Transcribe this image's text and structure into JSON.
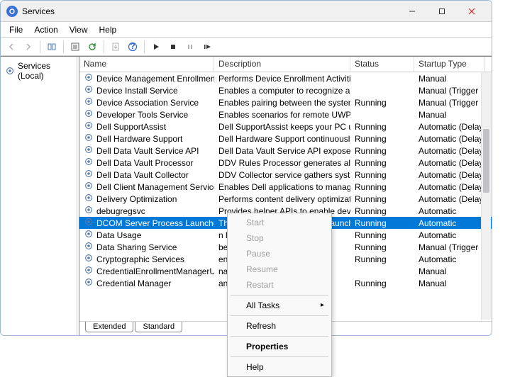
{
  "window": {
    "title": "Services"
  },
  "menu": {
    "file": "File",
    "action": "Action",
    "view": "View",
    "help": "Help"
  },
  "tree": {
    "root": "Services (Local)"
  },
  "columns": {
    "name": "Name",
    "desc": "Description",
    "status": "Status",
    "startup": "Startup Type"
  },
  "services": [
    {
      "name": "Device Management Enrollment Service",
      "desc": "Performs Device Enrollment Activities f...",
      "status": "",
      "startup": "Manual"
    },
    {
      "name": "Device Install Service",
      "desc": "Enables a computer to recognize and a...",
      "status": "",
      "startup": "Manual (Trigger St..."
    },
    {
      "name": "Device Association Service",
      "desc": "Enables pairing between the system an...",
      "status": "Running",
      "startup": "Manual (Trigger St..."
    },
    {
      "name": "Developer Tools Service",
      "desc": "Enables scenarios for remote UWP appli...",
      "status": "",
      "startup": "Manual"
    },
    {
      "name": "Dell SupportAssist",
      "desc": "Dell SupportAssist keeps your PC up to ...",
      "status": "Running",
      "startup": "Automatic (Delaye..."
    },
    {
      "name": "Dell Hardware Support",
      "desc": "Dell Hardware Support continuously m...",
      "status": "Running",
      "startup": "Automatic (Delaye..."
    },
    {
      "name": "Dell Data Vault Service API",
      "desc": "Dell Data Vault Service API exposes a C...",
      "status": "Running",
      "startup": "Automatic (Delaye..."
    },
    {
      "name": "Dell Data Vault Processor",
      "desc": "DDV Rules Processor generates alerts ba...",
      "status": "Running",
      "startup": "Automatic (Delaye..."
    },
    {
      "name": "Dell Data Vault Collector",
      "desc": "DDV Collector service gathers system in...",
      "status": "Running",
      "startup": "Automatic (Delaye..."
    },
    {
      "name": "Dell Client Management Service",
      "desc": "Enables Dell applications to manage Del...",
      "status": "Running",
      "startup": "Automatic (Delaye..."
    },
    {
      "name": "Delivery Optimization",
      "desc": "Performs content delivery optimization ...",
      "status": "Running",
      "startup": "Automatic (Delaye..."
    },
    {
      "name": "debugregsvc",
      "desc": "Provides helper APIs to enable device di...",
      "status": "Running",
      "startup": "Automatic"
    },
    {
      "name": "DCOM Server Process Launcher",
      "desc": "The DCOMLAUNCH service launches C...",
      "status": "Running",
      "startup": "Automatic",
      "selected": true
    },
    {
      "name": "Data Usage",
      "desc": "n limit, restrict ...",
      "status": "Running",
      "startup": "Automatic"
    },
    {
      "name": "Data Sharing Service",
      "desc": "between applic...",
      "status": "Running",
      "startup": "Manual (Trigger St..."
    },
    {
      "name": "Cryptographic Services",
      "desc": "ent services: C...",
      "status": "Running",
      "startup": "Automatic"
    },
    {
      "name": "CredentialEnrollmentManagerUserSvc...",
      "desc": "nager",
      "status": "",
      "startup": "Manual"
    },
    {
      "name": "Credential Manager",
      "desc": "and retrieval of",
      "status": "Running",
      "startup": "Manual"
    }
  ],
  "tabs": {
    "extended": "Extended",
    "standard": "Standard"
  },
  "context_menu": {
    "start": "Start",
    "stop": "Stop",
    "pause": "Pause",
    "resume": "Resume",
    "restart": "Restart",
    "all_tasks": "All Tasks",
    "refresh": "Refresh",
    "properties": "Properties",
    "help": "Help"
  }
}
